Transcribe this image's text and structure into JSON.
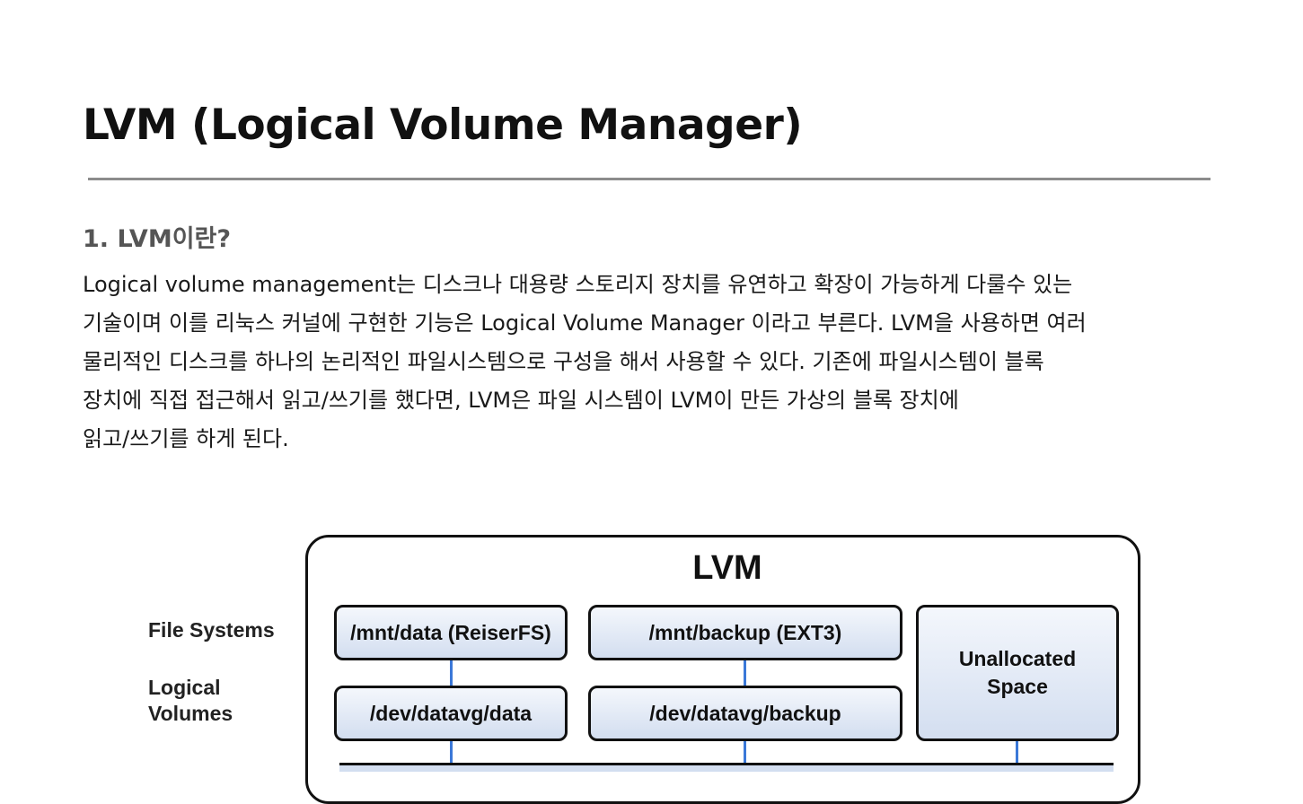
{
  "document": {
    "title": "LVM (Logical Volume Manager)",
    "section_heading": "1. LVM이란?",
    "paragraph_lines": [
      "Logical volume management는 디스크나 대용량 스토리지 장치를 유연하고 확장이 가능하게 다룰수 있는",
      "기술이며 이를 리눅스 커널에 구현한 기능은 Logical Volume Manager 이라고 부른다.  LVM을 사용하면 여러",
      "물리적인 디스크를 하나의 논리적인 파일시스템으로 구성을 해서  사용할 수 있다.  기존에 파일시스템이 블록",
      "장치에 직접 접근해서 읽고/쓰기를 했다면, LVM은 파일 시스템이 LVM이 만든 가상의 블록 장치에",
      "읽고/쓰기를 하게 된다."
    ]
  },
  "diagram": {
    "title": "LVM",
    "row_labels": {
      "file_systems": "File Systems",
      "logical_volumes_line1": "Logical",
      "logical_volumes_line2": "Volumes"
    },
    "file_systems": [
      "/mnt/data (ReiserFS)",
      "/mnt/backup (EXT3)"
    ],
    "logical_volumes": [
      "/dev/datavg/data",
      "/dev/datavg/backup"
    ],
    "unallocated_line1": "Unallocated",
    "unallocated_line2": "Space",
    "colors": {
      "box_fill_top": "#f4f7fc",
      "box_fill_bottom": "#d3def0",
      "connector": "#3b78d8",
      "rule": "#8c8c8c"
    }
  }
}
